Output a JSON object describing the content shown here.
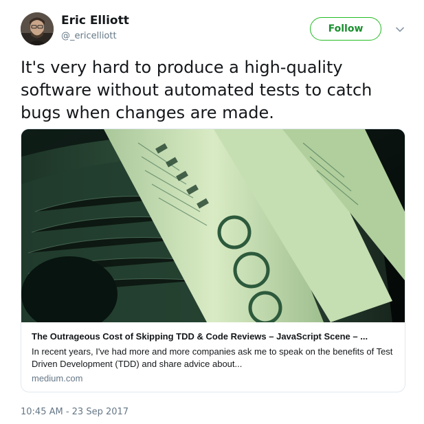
{
  "author": {
    "name": "Eric Elliott",
    "handle": "@_ericelliott"
  },
  "follow_label": "Follow",
  "menu_icon": "chevron-down-icon",
  "tweet": {
    "text": "It's very hard to produce a high-quality software without automated tests to catch bugs when changes are made."
  },
  "card": {
    "image_icon": "money-roll-photo",
    "title": "The Outrageous Cost of Skipping TDD & Code Reviews – JavaScript Scene – ...",
    "description": "In recent years, I've had more and more companies ask me to speak on the benefits of Test Driven Development (TDD) and share advice about...",
    "domain": "medium.com"
  },
  "timestamp": "10:45 AM - 23 Sep 2017",
  "colors": {
    "follow_border": "#22bb22",
    "follow_text": "#1a8f2e",
    "muted": "#657786"
  }
}
